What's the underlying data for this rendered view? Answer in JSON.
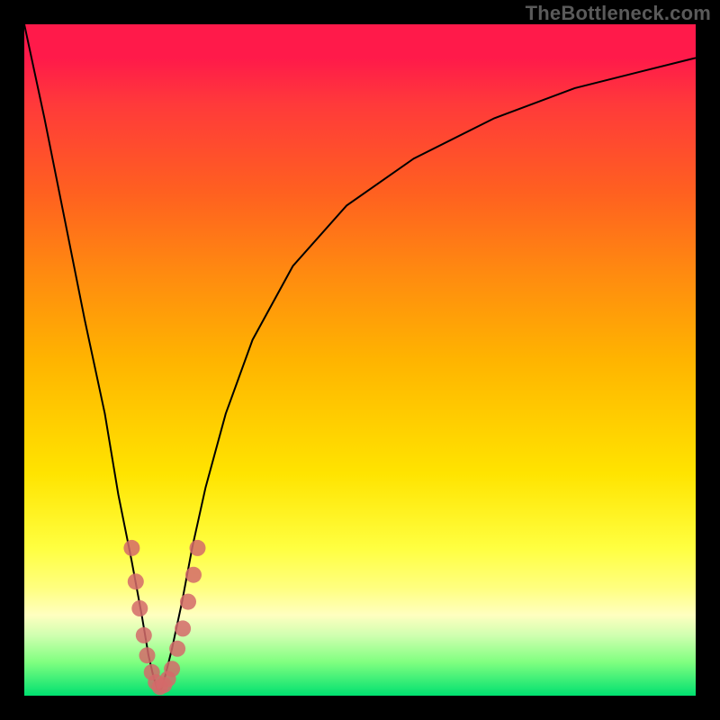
{
  "watermark": "TheBottleneck.com",
  "chart_data": {
    "type": "line",
    "title": "",
    "xlabel": "",
    "ylabel": "",
    "xlim": [
      0,
      100
    ],
    "ylim": [
      0,
      100
    ],
    "background_gradient": {
      "top_color": "#ff1a4a",
      "mid_color": "#ffe400",
      "bottom_color": "#00e070",
      "meaning": "top = bad / bottleneck, bottom = ideal / balanced"
    },
    "series": [
      {
        "name": "bottleneck-curve",
        "x": [
          0,
          3,
          6,
          9,
          12,
          14,
          16,
          17.5,
          18.5,
          19.2,
          19.8,
          20.4,
          21,
          22,
          23.5,
          25,
          27,
          30,
          34,
          40,
          48,
          58,
          70,
          82,
          92,
          100
        ],
        "y": [
          100,
          86,
          71,
          56,
          42,
          30,
          20,
          12,
          6,
          3,
          1,
          1,
          3,
          7,
          14,
          22,
          31,
          42,
          53,
          64,
          73,
          80,
          86,
          90.5,
          93,
          95
        ],
        "stroke": "#000000",
        "stroke_width": 2
      }
    ],
    "markers": {
      "name": "sample-points",
      "color": "#d46a6a",
      "radius_px": 9,
      "points": [
        {
          "x": 16.0,
          "y": 22.0
        },
        {
          "x": 16.6,
          "y": 17.0
        },
        {
          "x": 17.2,
          "y": 13.0
        },
        {
          "x": 17.8,
          "y": 9.0
        },
        {
          "x": 18.3,
          "y": 6.0
        },
        {
          "x": 19.0,
          "y": 3.5
        },
        {
          "x": 19.6,
          "y": 2.0
        },
        {
          "x": 20.2,
          "y": 1.3
        },
        {
          "x": 20.8,
          "y": 1.6
        },
        {
          "x": 21.4,
          "y": 2.5
        },
        {
          "x": 22.0,
          "y": 4.0
        },
        {
          "x": 22.8,
          "y": 7.0
        },
        {
          "x": 23.6,
          "y": 10.0
        },
        {
          "x": 24.4,
          "y": 14.0
        },
        {
          "x": 25.2,
          "y": 18.0
        },
        {
          "x": 25.8,
          "y": 22.0
        }
      ]
    }
  }
}
